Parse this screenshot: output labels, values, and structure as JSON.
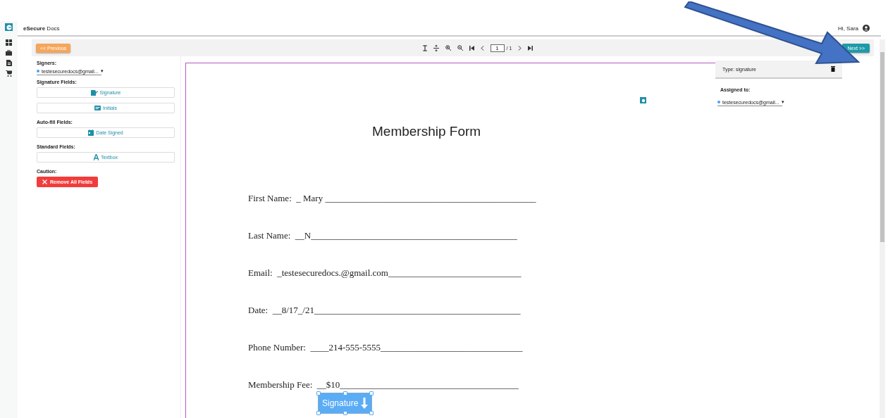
{
  "header": {
    "brand": "**eSecure** Docs",
    "greeting": "Hi, Sara"
  },
  "toolbar": {
    "previous": "<< Previous",
    "next": "Next >>",
    "page_input": "1",
    "page_total": "/ 1"
  },
  "left_panel": {
    "signers_label": "Signers:",
    "signer": {
      "email": "testesecuredocs@gmail...",
      "color": "#4a9ef5",
      "caret": "▾"
    },
    "sections": [
      {
        "label": "Signature Fields:",
        "buttons": [
          {
            "kind": "signature",
            "label": "Signature"
          },
          {
            "kind": "initials",
            "label": "Initials"
          }
        ]
      },
      {
        "label": "Auto-fill Fields:",
        "buttons": [
          {
            "kind": "date",
            "label": "Date Signed"
          }
        ]
      },
      {
        "label": "Standard Fields:",
        "buttons": [
          {
            "kind": "text",
            "label": "Textbox"
          }
        ]
      }
    ],
    "caution_label": "Caution:",
    "remove_button": "Remove All Fields"
  },
  "document": {
    "title": "Membership Form",
    "lines": [
      "First Name:  _ Mary ______________________________________________",
      "Last Name:  __N_____________________________________________",
      "Email:  _testesecuredocs.@gmail.com_____________________________",
      "Date:  __8/17_/21_____________________________________________",
      "Phone Number:  ____214-555-5555_______________________________",
      "Membership Fee:  __$10_______________________________________"
    ],
    "signature_field": "Signature"
  },
  "right_panel": {
    "type_label": "Type: signature",
    "assigned_label": "Assigned to:",
    "assignee": {
      "email": "testesecuredocs@gmail...",
      "color": "#4a9ef5",
      "caret": "▾"
    }
  }
}
